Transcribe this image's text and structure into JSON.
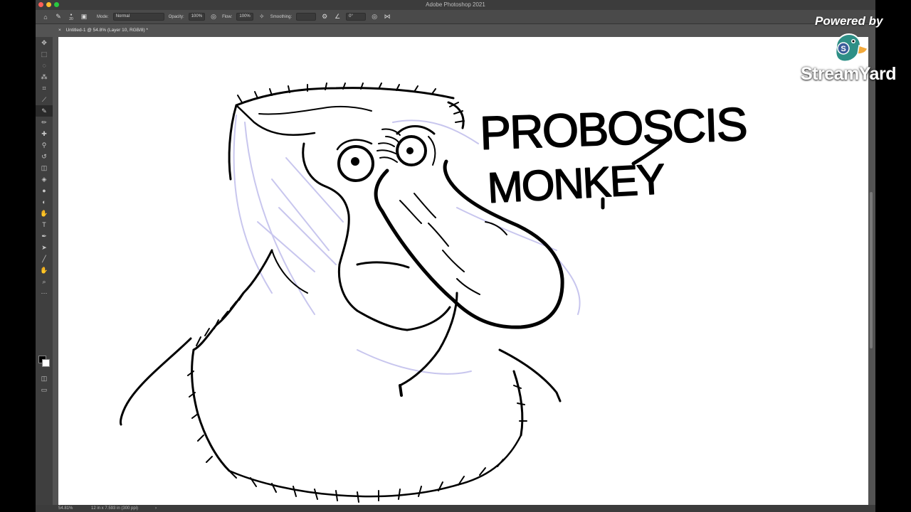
{
  "window": {
    "title": "Adobe Photoshop 2021",
    "lights": [
      "#ff5f57",
      "#febc2e",
      "#28c840"
    ]
  },
  "options_bar": {
    "brush_size": "20",
    "mode_label": "Mode:",
    "mode_value": "Normal",
    "opacity_label": "Opacity:",
    "opacity_value": "100%",
    "flow_label": "Flow:",
    "flow_value": "100%",
    "smoothing_label": "Smoothing:",
    "angle_value": "0°"
  },
  "document": {
    "tab_title": "Untitled-1 @ 54.8% (Layer 10, RGB/8) *",
    "canvas_text_line1": "PROBOSCIS",
    "canvas_text_line2": "MONKEY"
  },
  "tools": [
    {
      "name": "move-tool",
      "icon": "✥"
    },
    {
      "name": "marquee-tool",
      "icon": "⬚"
    },
    {
      "name": "lasso-tool",
      "icon": "◌"
    },
    {
      "name": "quick-select-tool",
      "icon": "⁂"
    },
    {
      "name": "crop-tool",
      "icon": "⌗"
    },
    {
      "name": "eyedropper-tool",
      "icon": "⟋"
    },
    {
      "name": "brush-tool",
      "icon": "✎"
    },
    {
      "name": "pencil-tool",
      "icon": "✏"
    },
    {
      "name": "healing-tool",
      "icon": "✚"
    },
    {
      "name": "clone-stamp-tool",
      "icon": "⚲"
    },
    {
      "name": "history-brush-tool",
      "icon": "↺"
    },
    {
      "name": "eraser-tool",
      "icon": "◫"
    },
    {
      "name": "paint-bucket-tool",
      "icon": "◈"
    },
    {
      "name": "blur-tool",
      "icon": "●"
    },
    {
      "name": "dodge-tool",
      "icon": "◐"
    },
    {
      "name": "smudge-tool",
      "icon": "✋"
    },
    {
      "name": "type-tool",
      "icon": "T"
    },
    {
      "name": "pen-tool",
      "icon": "✒"
    },
    {
      "name": "path-select-tool",
      "icon": "➤"
    },
    {
      "name": "line-tool",
      "icon": "╱"
    },
    {
      "name": "hand-tool",
      "icon": "✋"
    },
    {
      "name": "zoom-tool",
      "icon": "⌕"
    },
    {
      "name": "more-tools",
      "icon": "⋯"
    }
  ],
  "status": {
    "zoom": "54.81%",
    "doc_info": "12 in x 7.593 in (300 ppi)",
    "arrow": "›"
  },
  "overlay": {
    "powered_by": "Powered by",
    "brand": "StreamYard",
    "duck_icon": "duck-logo-icon"
  }
}
